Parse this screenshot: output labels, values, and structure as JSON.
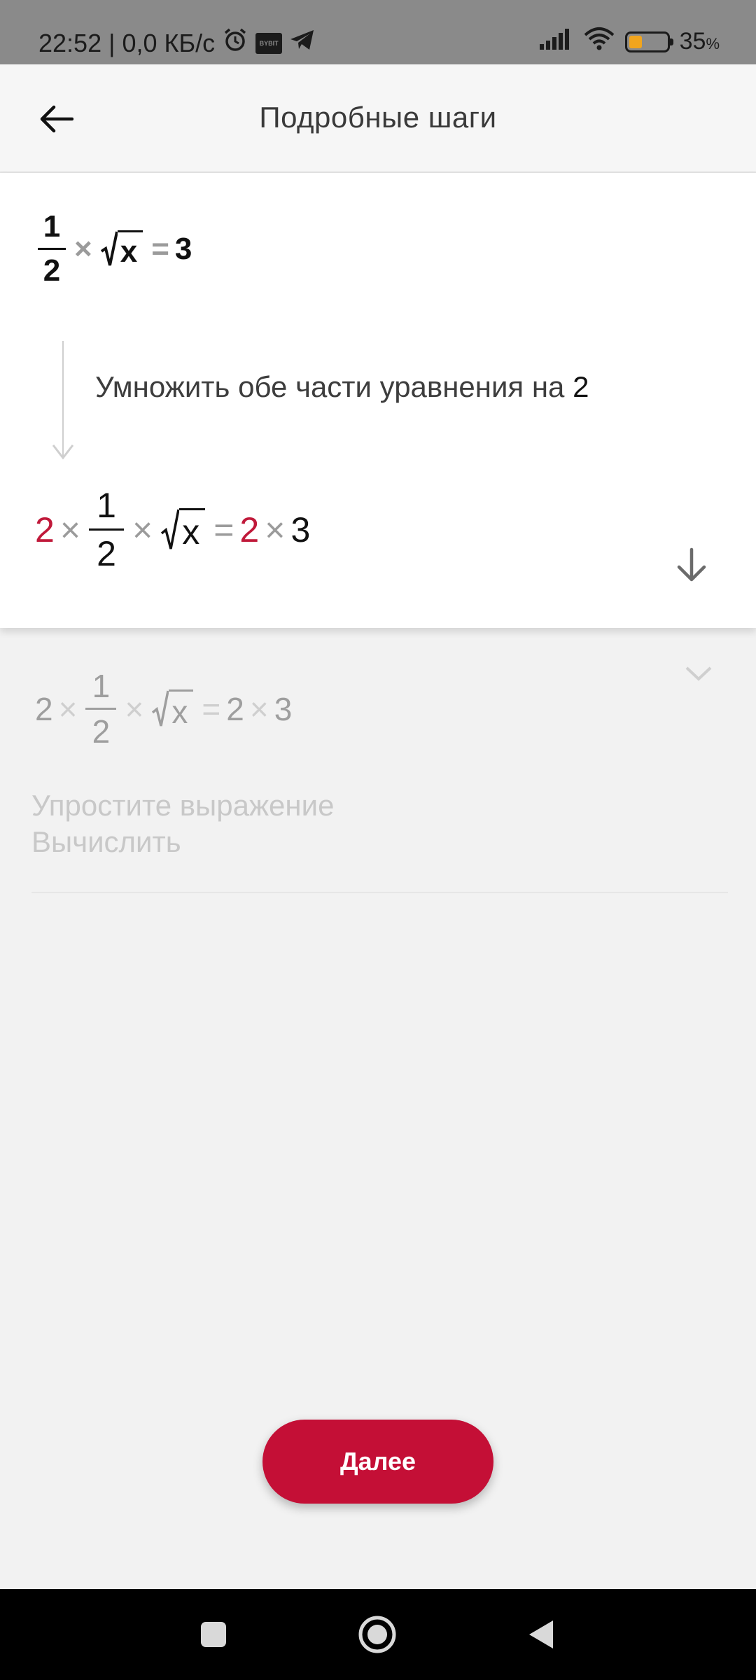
{
  "status_bar": {
    "time_speed": "22:52 | 0,0 КБ/с",
    "bybit_label": "BYBIT",
    "battery_percent": "35",
    "battery_unit": "%",
    "battery_level": 0.35,
    "icons": [
      "alarm-icon",
      "bybit-icon",
      "telegram-icon",
      "signal-icon",
      "wifi-icon",
      "battery-icon"
    ]
  },
  "header": {
    "title": "Подробные шаги",
    "back_icon": "arrow-left-icon"
  },
  "step": {
    "equation_initial": {
      "frac_num": "1",
      "frac_den": "2",
      "times": "×",
      "radicand": "x",
      "equals": "=",
      "rhs": "3"
    },
    "description_text": "Умножить обе части уравнения на ",
    "description_value": "2",
    "equation_result": {
      "left_factor": "2",
      "times": "×",
      "frac_num": "1",
      "frac_den": "2",
      "radicand": "x",
      "equals": "=",
      "right_factor": "2",
      "rhs": "3"
    }
  },
  "next_step": {
    "equation": {
      "left_factor": "2",
      "times": "×",
      "frac_num": "1",
      "frac_den": "2",
      "radicand": "x",
      "equals": "=",
      "right_factor": "2",
      "rhs": "3"
    },
    "line1": "Упростите выражение",
    "line2": "Вычислить"
  },
  "buttons": {
    "next_label": "Далее"
  },
  "colors": {
    "accent": "#c40f36",
    "highlight": "#c0193a",
    "battery": "#f1a51d"
  }
}
